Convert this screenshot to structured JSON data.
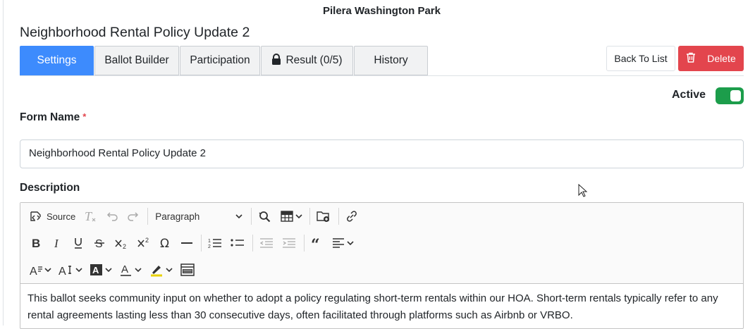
{
  "org_name": "Pilera Washington Park",
  "page_title": "Neighborhood Rental Policy Update 2",
  "tabs": [
    {
      "label": "Settings"
    },
    {
      "label": "Ballot Builder"
    },
    {
      "label": "Participation"
    },
    {
      "label": "Result (0/5)",
      "icon": "lock-icon"
    },
    {
      "label": "History"
    }
  ],
  "actions": {
    "back_label": "Back To List",
    "delete_label": "Delete"
  },
  "colors": {
    "primary": "#3d8bfd",
    "danger": "#e3454d",
    "success": "#1c9d4b"
  },
  "status": {
    "label": "Active",
    "on": true
  },
  "form": {
    "name_label": "Form Name",
    "required_mark": "*",
    "name_value": "Neighborhood Rental Policy Update 2",
    "description_label": "Description"
  },
  "editor": {
    "source_label": "Source",
    "paragraph_label": "Paragraph",
    "content": "This ballot seeks community input on whether to adopt a policy regulating short-term rentals within our HOA. Short-term rentals typically refer to any rental agreements lasting less than 30 consecutive days, often facilitated through platforms such as Airbnb or VRBO."
  }
}
